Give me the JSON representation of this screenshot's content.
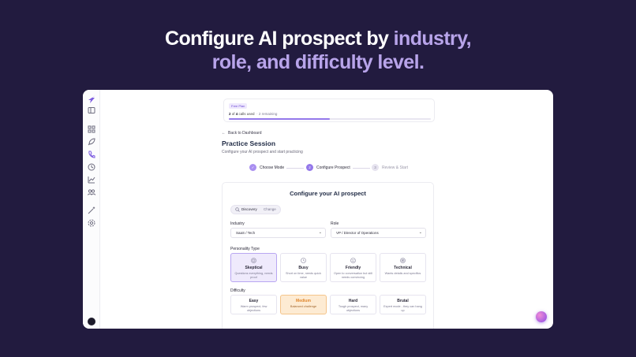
{
  "hero": {
    "line1_white": "Configure AI prospect by ",
    "line1_purple": "industry,",
    "line2_purple": "role, and difficulty level."
  },
  "colors": {
    "background": "#221b3f",
    "accent": "#9478ea",
    "hero_purple": "#b8a4ea",
    "medium_orange": "#e0862c"
  },
  "sidebar": {
    "icons": [
      "logo-icon",
      "panel-toggle-icon",
      "grid-icon",
      "rocket-icon",
      "phone-icon",
      "history-icon",
      "chart-icon",
      "users-icon",
      "magic-icon",
      "settings-icon"
    ]
  },
  "plan": {
    "badge": "Free Plan",
    "used": "2",
    "of": " of ",
    "total": "4",
    "calls_used": " calls used",
    "remaining": "· 2 remaining",
    "progress": 0.5
  },
  "nav": {
    "back_label": "Back to Dashboard"
  },
  "page": {
    "title": "Practice Session",
    "subtitle": "Configure your AI prospect and start practicing"
  },
  "steps": [
    {
      "label": "Choose Mode",
      "marker": "✓"
    },
    {
      "label": "Configure Prospect",
      "marker": "2"
    },
    {
      "label": "Review & Start",
      "marker": "3"
    }
  ],
  "config": {
    "title": "Configure your AI prospect",
    "mode": {
      "value": "Discovery",
      "change_label": "Change"
    },
    "industry": {
      "label": "Industry",
      "value": "SaaS / Tech"
    },
    "role": {
      "label": "Role",
      "value": "VP / Director of Operations"
    },
    "personality_label": "Personality Type",
    "personalities": [
      {
        "title": "Skeptical",
        "desc": "Questions everything, needs proof",
        "icon": "shield-icon"
      },
      {
        "title": "Busy",
        "desc": "Short on time, needs quick value",
        "icon": "clock-icon"
      },
      {
        "title": "Friendly",
        "desc": "Open to conversation but still needs convincing",
        "icon": "smile-icon"
      },
      {
        "title": "Technical",
        "desc": "Wants details and specifics",
        "icon": "target-icon"
      }
    ],
    "difficulty_label": "Difficulty",
    "difficulties": [
      {
        "title": "Easy",
        "desc": "Warm prospect, few objections"
      },
      {
        "title": "Medium",
        "desc": "Balanced challenge"
      },
      {
        "title": "Hard",
        "desc": "Tough prospect, many objections"
      },
      {
        "title": "Brutal",
        "desc": "Expert mode - they can hang up"
      }
    ]
  }
}
